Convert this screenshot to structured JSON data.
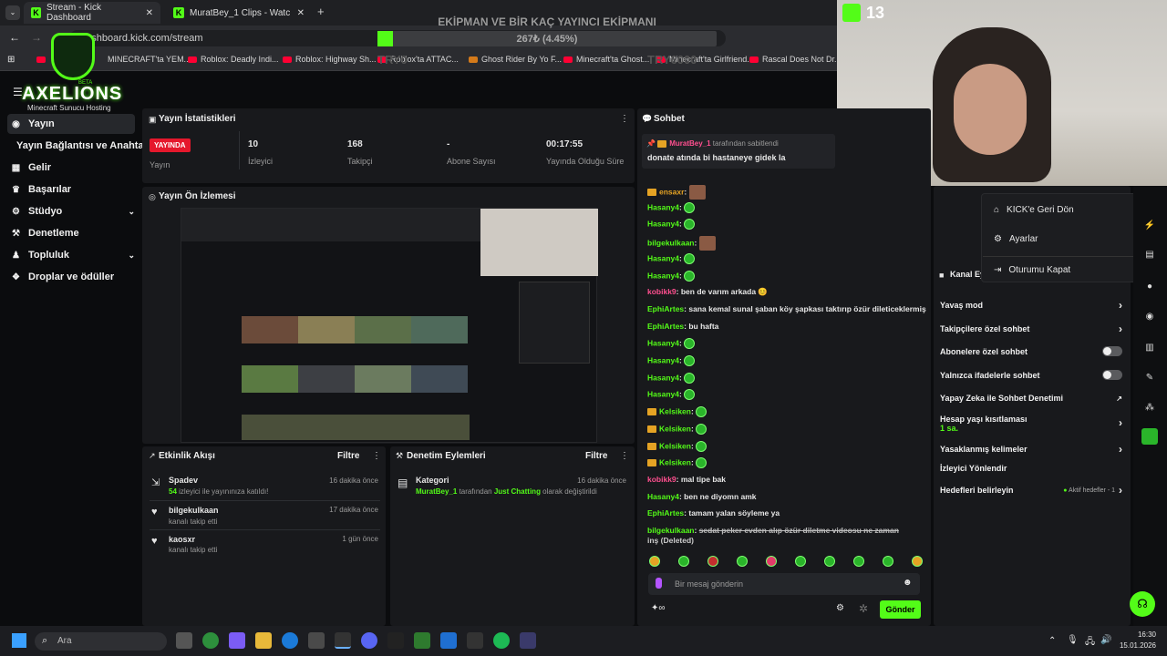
{
  "browser": {
    "tabs": [
      {
        "label": "Stream - Kick Dashboard",
        "active": true
      },
      {
        "label": "MuratBey_1 Clips - Watch Live",
        "active": false
      }
    ],
    "url": "dashboard.kick.com/stream",
    "bookmarks": [
      "MINECRAFT'ta YEM...",
      "Roblox: Deadly Indi...",
      "Roblox: Highway Sh...",
      "Roblox'ta ATTAC...",
      "Ghost Rider By Yo F...",
      "Minecraft'ta Ghost...",
      "Minecraft'ta Girlfriend...",
      "Rascal Does Not Dr..."
    ]
  },
  "overlay": {
    "brand": "AXELIONS",
    "brand_sub": "Minecraft Sunucu Hosting",
    "brand_beta": "BETA",
    "goal_title": "EKİPMAN VE BİR KAÇ YAYINCI EKİPMANI",
    "goal_text": "267₺ (4.45%)",
    "goal_progress": 0.0445,
    "goal_left": "TRY0",
    "goal_right": "TRY6000",
    "viewer_count": "13"
  },
  "sidebar": {
    "items": [
      {
        "label": "Yayın",
        "icon": "broadcast-icon",
        "active": true
      },
      {
        "label": "Yayın Bağlantısı ve Anahtarı",
        "icon": "",
        "active": false
      },
      {
        "label": "Gelir",
        "icon": "revenue-icon",
        "active": false
      },
      {
        "label": "Başarılar",
        "icon": "trophy-icon",
        "active": false
      },
      {
        "label": "Stüdyo",
        "icon": "studio-icon",
        "active": false,
        "expand": true
      },
      {
        "label": "Denetleme",
        "icon": "moderation-icon",
        "active": false
      },
      {
        "label": "Topluluk",
        "icon": "community-icon",
        "active": false,
        "expand": true
      },
      {
        "label": "Droplar ve ödüller",
        "icon": "drops-icon",
        "active": false
      }
    ]
  },
  "stats": {
    "title": "Yayın İstatistikleri",
    "live_badge": "YAYINDA",
    "items": [
      {
        "value": "",
        "label": "Yayın"
      },
      {
        "value": "10",
        "label": "İzleyici"
      },
      {
        "value": "168",
        "label": "Takipçi"
      },
      {
        "value": "-",
        "label": "Abone Sayısı"
      },
      {
        "value": "00:17:55",
        "label": "Yayında Olduğu Süre"
      }
    ]
  },
  "preview": {
    "title": "Yayın Ön İzlemesi"
  },
  "activity": {
    "title": "Etkinlik Akışı",
    "filter": "Filtre",
    "items": [
      {
        "name": "Spadev",
        "detail_count": "54",
        "detail": " izleyici ile yayınınıza katıldı!",
        "time": "16 dakika önce",
        "icon": "raid-icon"
      },
      {
        "name": "bilgekulkaan",
        "detail_count": "",
        "detail": "kanalı takip etti",
        "time": "17 dakika önce",
        "icon": "heart-icon"
      },
      {
        "name": "kaosxr",
        "detail_count": "",
        "detail": "kanalı takip etti",
        "time": "1 gün önce",
        "icon": "heart-icon"
      }
    ]
  },
  "modlog": {
    "title": "Denetim Eylemleri",
    "filter": "Filtre",
    "item": {
      "name": "Kategori",
      "user": "MuratBey_1",
      "text1": " tarafından ",
      "category": "Just Chatting",
      "text2": " olarak değiştirildi",
      "time": "16 dakika önce"
    }
  },
  "chat": {
    "title": "Sohbet",
    "pinned_user": "MuratBey_1",
    "pinned_suffix": " tarafından sabitlendi",
    "pinned_msg": "donate atında bi hastaneye gidek la",
    "messages": [
      {
        "user": "ensaxr",
        "color": "#e5a324",
        "text": "",
        "emote": "img"
      },
      {
        "user": "Hasany4",
        "color": "#53fc18",
        "text": "",
        "emote": "e"
      },
      {
        "user": "Hasany4",
        "color": "#53fc18",
        "text": "",
        "emote": "e"
      },
      {
        "user": "bilgekulkaan",
        "color": "#53fc18",
        "text": "",
        "emote": "img"
      },
      {
        "user": "Hasany4",
        "color": "#53fc18",
        "text": "",
        "emote": "e"
      },
      {
        "user": "Hasany4",
        "color": "#53fc18",
        "text": "",
        "emote": "e"
      },
      {
        "user": "kobikk9",
        "color": "#ff4f8f",
        "text": "ben de varım arkada 😊",
        "emote": ""
      },
      {
        "user": "EphiArtes",
        "color": "#53fc18",
        "text": "sana kemal sunal şaban köy şapkası taktırıp özür dileticeklermiş",
        "emote": ""
      },
      {
        "user": "EphiArtes",
        "color": "#53fc18",
        "text": "bu hafta",
        "emote": ""
      },
      {
        "user": "Hasany4",
        "color": "#53fc18",
        "text": "",
        "emote": "e"
      },
      {
        "user": "Hasany4",
        "color": "#53fc18",
        "text": "",
        "emote": "e"
      },
      {
        "user": "Hasany4",
        "color": "#53fc18",
        "text": "",
        "emote": "e"
      },
      {
        "user": "Hasany4",
        "color": "#53fc18",
        "text": "",
        "emote": "e"
      },
      {
        "user": "Kelsiken",
        "color": "#53fc18",
        "text": "",
        "emote": "e"
      },
      {
        "user": "Kelsiken",
        "color": "#53fc18",
        "text": "",
        "emote": "e"
      },
      {
        "user": "Kelsiken",
        "color": "#53fc18",
        "text": "",
        "emote": "e"
      },
      {
        "user": "Kelsiken",
        "color": "#53fc18",
        "text": "",
        "emote": "e"
      },
      {
        "user": "kobikk9",
        "color": "#ff4f8f",
        "text": "mal tipe bak",
        "emote": ""
      },
      {
        "user": "Hasany4",
        "color": "#53fc18",
        "text": "ben ne diyomn amk",
        "emote": ""
      },
      {
        "user": "EphiArtes",
        "color": "#53fc18",
        "text": "tamam yalan söyleme ya",
        "emote": ""
      },
      {
        "user": "bilgekulkaan",
        "color": "#53fc18",
        "text": "sedat peker evden alıp özür diletme videosu ne zaman",
        "emote": ""
      }
    ],
    "deleted_tail": "inş (Deleted)",
    "input_placeholder": "Bir mesaj gönderin",
    "send": "Gönder"
  },
  "channel": {
    "title": "Kanal Ey",
    "settings": [
      {
        "label": "Yavaş mod",
        "control": "chevron"
      },
      {
        "label": "Takipçilere özel sohbet",
        "control": "chevron"
      },
      {
        "label": "Abonelere özel sohbet",
        "control": "toggle"
      },
      {
        "label": "Yalnızca ifadelerle sohbet",
        "control": "toggle"
      },
      {
        "label": "Yapay Zeka ile Sohbet Denetimi",
        "control": "external"
      },
      {
        "label": "Hesap yaşı kısıtlaması",
        "sub": "1 sa.",
        "control": "chevron"
      },
      {
        "label": "Yasaklanmış kelimeler",
        "control": "chevron"
      },
      {
        "label": "İzleyici Yönlendir",
        "control": ""
      },
      {
        "label": "Hedefleri belirleyin",
        "extra": "Aktif hedefler - 1",
        "control": "chevron"
      }
    ]
  },
  "user_menu": {
    "items": [
      "KICK'e Geri Dön",
      "Ayarlar",
      "Oturumu Kapat"
    ]
  },
  "taskbar": {
    "search": "Ara",
    "time": "16:30",
    "date": "15.01.2026"
  },
  "colors": {
    "accent": "#53fc18",
    "live": "#e5182c"
  }
}
